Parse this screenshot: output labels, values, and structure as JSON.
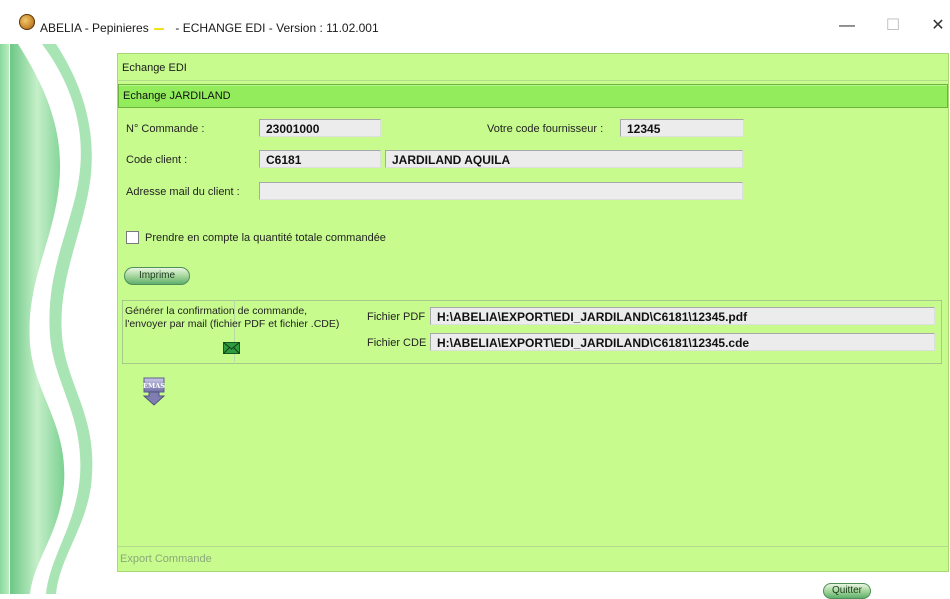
{
  "window": {
    "title": "ABELIA - Pepinieres",
    "title_suffix": "- ECHANGE EDI - Version : 11.02.001",
    "min_glyph": "—",
    "max_glyph": "☐",
    "close_glyph": "✕"
  },
  "panel": {
    "title": "Echange EDI",
    "sub_title": "Echange JARDILAND"
  },
  "form": {
    "order_label": "N° Commande :",
    "order_value": "23001000",
    "supplier_label": "Votre code fournisseur :",
    "supplier_value": "12345",
    "client_label": "Code client :",
    "client_code": "C6181",
    "client_name": "JARDILAND AQUILA",
    "email_label": "Adresse mail  du client :",
    "email_value": "",
    "checkbox_label": "Prendre en compte la quantité totale commandée",
    "checkbox_checked": false,
    "print_button": "Imprime"
  },
  "export": {
    "description_line1": "Générer la confirmation de commande,",
    "description_line2": "l'envoyer par mail  (fichier PDF et fichier .CDE)",
    "pdf_label": "Fichier PDF",
    "pdf_path": "H:\\ABELIA\\EXPORT\\EDI_JARDILAND\\C6181\\12345.pdf",
    "cde_label": "Fichier CDE",
    "cde_path": "H:\\ABELIA\\EXPORT\\EDI_JARDILAND\\C6181\\12345.cde",
    "send_icon": "envelope-icon",
    "emas_icon_text": "EMAS"
  },
  "footer": {
    "label": "Export Commande",
    "quit_button": "Quitter"
  },
  "colors": {
    "panel_bg": "#c8fb8e",
    "header_bg": "#93ec5b",
    "field_bg": "#ececec",
    "accent": "#5fb06d"
  }
}
